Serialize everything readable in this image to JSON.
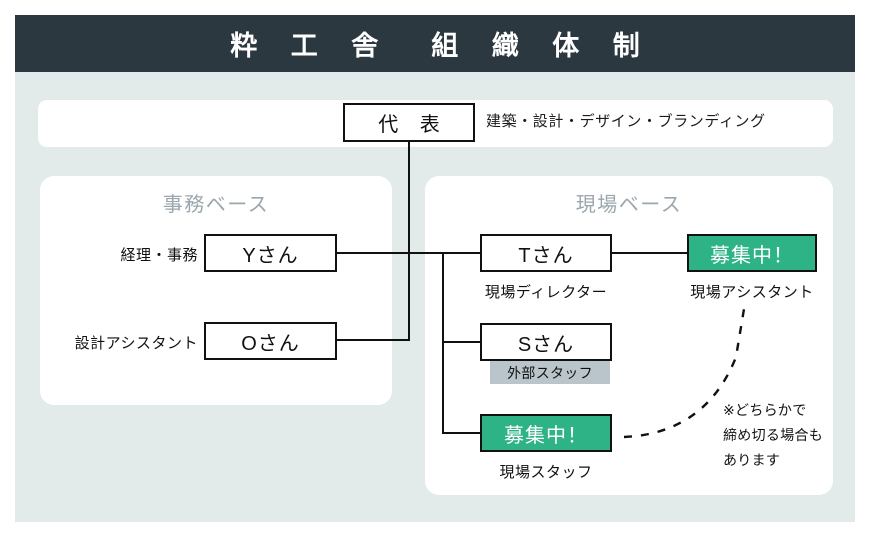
{
  "header": {
    "title": "粋 工 舎　組 織 体 制"
  },
  "top": {
    "rep_label": "代 表",
    "subtitle": "建築・設計・デザイン・ブランディング"
  },
  "panels": {
    "office": {
      "title": "事務ベース",
      "rows": [
        {
          "label": "経理・事務",
          "name": "Yさん"
        },
        {
          "label": "設計アシスタント",
          "name": "Oさん"
        }
      ]
    },
    "site": {
      "title": "現場ベース",
      "nodes": [
        {
          "name": "Tさん",
          "caption": "現場ディレクター",
          "status": "filled"
        },
        {
          "name": "募集中！",
          "caption": "現場アシスタント",
          "status": "recruiting"
        },
        {
          "name": "Sさん",
          "caption": "外部スタッフ",
          "status": "external"
        },
        {
          "name": "募集中！",
          "caption": "現場スタッフ",
          "status": "recruiting"
        }
      ]
    }
  },
  "note": {
    "line1": "※どちらかで",
    "line2": "締め切る場合も",
    "line3": "あります"
  },
  "colors": {
    "header_bg": "#2c3840",
    "page_bg": "#e3eaea",
    "panel_bg": "#ffffff",
    "recruiting_green": "#2eb387",
    "external_gray": "#b9c5ca",
    "panel_title": "#9aa7ad",
    "line": "#111111"
  }
}
